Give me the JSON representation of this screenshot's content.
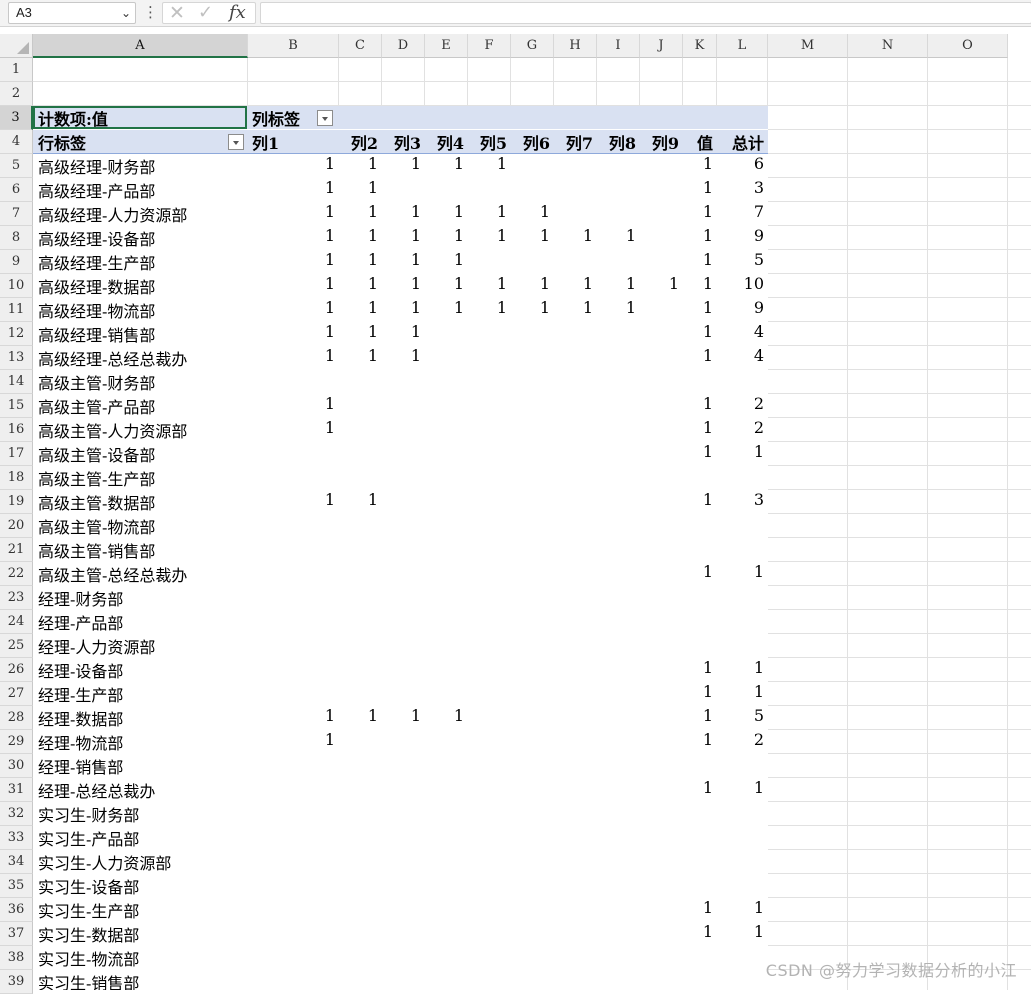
{
  "formula_bar": {
    "name_box": "A3",
    "formula_icon": "fx",
    "formula": ""
  },
  "columns": [
    "A",
    "B",
    "C",
    "D",
    "E",
    "F",
    "G",
    "H",
    "I",
    "J",
    "K",
    "L",
    "M",
    "N",
    "O"
  ],
  "pivot": {
    "corner_label": "计数项:值",
    "col_filter_label": "列标签",
    "row_filter_label": "行标签",
    "headers": [
      "列1",
      "列2",
      "列3",
      "列4",
      "列5",
      "列6",
      "列7",
      "列8",
      "列9",
      "值",
      "总计"
    ],
    "rows": [
      {
        "label": "高级经理-财务部",
        "values": [
          "1",
          "1",
          "1",
          "1",
          "1",
          "",
          "",
          "",
          "",
          "1",
          "6"
        ]
      },
      {
        "label": "高级经理-产品部",
        "values": [
          "1",
          "1",
          "",
          "",
          "",
          "",
          "",
          "",
          "",
          "1",
          "3"
        ]
      },
      {
        "label": "高级经理-人力资源部",
        "values": [
          "1",
          "1",
          "1",
          "1",
          "1",
          "1",
          "",
          "",
          "",
          "1",
          "7"
        ]
      },
      {
        "label": "高级经理-设备部",
        "values": [
          "1",
          "1",
          "1",
          "1",
          "1",
          "1",
          "1",
          "1",
          "",
          "1",
          "9"
        ]
      },
      {
        "label": "高级经理-生产部",
        "values": [
          "1",
          "1",
          "1",
          "1",
          "",
          "",
          "",
          "",
          "",
          "1",
          "5"
        ]
      },
      {
        "label": "高级经理-数据部",
        "values": [
          "1",
          "1",
          "1",
          "1",
          "1",
          "1",
          "1",
          "1",
          "1",
          "1",
          "10"
        ]
      },
      {
        "label": "高级经理-物流部",
        "values": [
          "1",
          "1",
          "1",
          "1",
          "1",
          "1",
          "1",
          "1",
          "",
          "1",
          "9"
        ]
      },
      {
        "label": "高级经理-销售部",
        "values": [
          "1",
          "1",
          "1",
          "",
          "",
          "",
          "",
          "",
          "",
          "1",
          "4"
        ]
      },
      {
        "label": "高级经理-总经总裁办",
        "values": [
          "1",
          "1",
          "1",
          "",
          "",
          "",
          "",
          "",
          "",
          "1",
          "4"
        ]
      },
      {
        "label": "高级主管-财务部",
        "values": [
          "",
          "",
          "",
          "",
          "",
          "",
          "",
          "",
          "",
          "",
          ""
        ]
      },
      {
        "label": "高级主管-产品部",
        "values": [
          "1",
          "",
          "",
          "",
          "",
          "",
          "",
          "",
          "",
          "1",
          "2"
        ]
      },
      {
        "label": "高级主管-人力资源部",
        "values": [
          "1",
          "",
          "",
          "",
          "",
          "",
          "",
          "",
          "",
          "1",
          "2"
        ]
      },
      {
        "label": "高级主管-设备部",
        "values": [
          "",
          "",
          "",
          "",
          "",
          "",
          "",
          "",
          "",
          "1",
          "1"
        ]
      },
      {
        "label": "高级主管-生产部",
        "values": [
          "",
          "",
          "",
          "",
          "",
          "",
          "",
          "",
          "",
          "",
          ""
        ]
      },
      {
        "label": "高级主管-数据部",
        "values": [
          "1",
          "1",
          "",
          "",
          "",
          "",
          "",
          "",
          "",
          "1",
          "3"
        ]
      },
      {
        "label": "高级主管-物流部",
        "values": [
          "",
          "",
          "",
          "",
          "",
          "",
          "",
          "",
          "",
          "",
          ""
        ]
      },
      {
        "label": "高级主管-销售部",
        "values": [
          "",
          "",
          "",
          "",
          "",
          "",
          "",
          "",
          "",
          "",
          ""
        ]
      },
      {
        "label": "高级主管-总经总裁办",
        "values": [
          "",
          "",
          "",
          "",
          "",
          "",
          "",
          "",
          "",
          "1",
          "1"
        ]
      },
      {
        "label": "经理-财务部",
        "values": [
          "",
          "",
          "",
          "",
          "",
          "",
          "",
          "",
          "",
          "",
          ""
        ]
      },
      {
        "label": "经理-产品部",
        "values": [
          "",
          "",
          "",
          "",
          "",
          "",
          "",
          "",
          "",
          "",
          ""
        ]
      },
      {
        "label": "经理-人力资源部",
        "values": [
          "",
          "",
          "",
          "",
          "",
          "",
          "",
          "",
          "",
          "",
          ""
        ]
      },
      {
        "label": "经理-设备部",
        "values": [
          "",
          "",
          "",
          "",
          "",
          "",
          "",
          "",
          "",
          "1",
          "1"
        ]
      },
      {
        "label": "经理-生产部",
        "values": [
          "",
          "",
          "",
          "",
          "",
          "",
          "",
          "",
          "",
          "1",
          "1"
        ]
      },
      {
        "label": "经理-数据部",
        "values": [
          "1",
          "1",
          "1",
          "1",
          "",
          "",
          "",
          "",
          "",
          "1",
          "5"
        ]
      },
      {
        "label": "经理-物流部",
        "values": [
          "1",
          "",
          "",
          "",
          "",
          "",
          "",
          "",
          "",
          "1",
          "2"
        ]
      },
      {
        "label": "经理-销售部",
        "values": [
          "",
          "",
          "",
          "",
          "",
          "",
          "",
          "",
          "",
          "",
          ""
        ]
      },
      {
        "label": "经理-总经总裁办",
        "values": [
          "",
          "",
          "",
          "",
          "",
          "",
          "",
          "",
          "",
          "1",
          "1"
        ]
      },
      {
        "label": "实习生-财务部",
        "values": [
          "",
          "",
          "",
          "",
          "",
          "",
          "",
          "",
          "",
          "",
          ""
        ]
      },
      {
        "label": "实习生-产品部",
        "values": [
          "",
          "",
          "",
          "",
          "",
          "",
          "",
          "",
          "",
          "",
          ""
        ]
      },
      {
        "label": "实习生-人力资源部",
        "values": [
          "",
          "",
          "",
          "",
          "",
          "",
          "",
          "",
          "",
          "",
          ""
        ]
      },
      {
        "label": "实习生-设备部",
        "values": [
          "",
          "",
          "",
          "",
          "",
          "",
          "",
          "",
          "",
          "",
          ""
        ]
      },
      {
        "label": "实习生-生产部",
        "values": [
          "",
          "",
          "",
          "",
          "",
          "",
          "",
          "",
          "",
          "1",
          "1"
        ]
      },
      {
        "label": "实习生-数据部",
        "values": [
          "",
          "",
          "",
          "",
          "",
          "",
          "",
          "",
          "",
          "1",
          "1"
        ]
      },
      {
        "label": "实习生-物流部",
        "values": [
          "",
          "",
          "",
          "",
          "",
          "",
          "",
          "",
          "",
          "",
          ""
        ]
      },
      {
        "label": "实习生-销售部",
        "values": [
          "",
          "",
          "",
          "",
          "",
          "",
          "",
          "",
          "",
          "",
          ""
        ]
      }
    ]
  },
  "watermark": "CSDN @努力学习数据分析的小江",
  "colors": {
    "selection": "#217346",
    "pivot_header_fill": "#d9e1f2"
  }
}
